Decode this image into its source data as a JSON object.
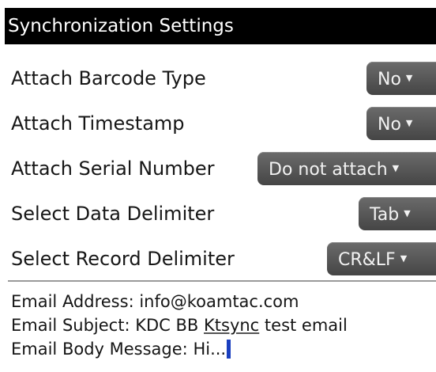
{
  "title": "Synchronization Settings",
  "settings": [
    {
      "label": "Attach Barcode Type",
      "value": "No"
    },
    {
      "label": "Attach Timestamp",
      "value": "No"
    },
    {
      "label": "Attach Serial Number",
      "value": "Do not attach"
    },
    {
      "label": "Select Data Delimiter",
      "value": "Tab"
    },
    {
      "label": "Select Record Delimiter",
      "value": "CR&LF"
    }
  ],
  "email": {
    "address_label": "Email Address:",
    "address_value": "info@koamtac.com",
    "subject_label": "Email Subject:",
    "subject_value_prefix": "KDC BB",
    "subject_value_misspelled": "Ktsync",
    "subject_value_suffix": "test email",
    "body_label": "Email Body Message:",
    "body_value": "Hi..."
  },
  "colors": {
    "title_bg": "#000000",
    "dropdown_bg": "#555555",
    "cursor": "#1a3fbf"
  },
  "icons": {
    "dropdown_arrow": "triangle-down-icon"
  }
}
